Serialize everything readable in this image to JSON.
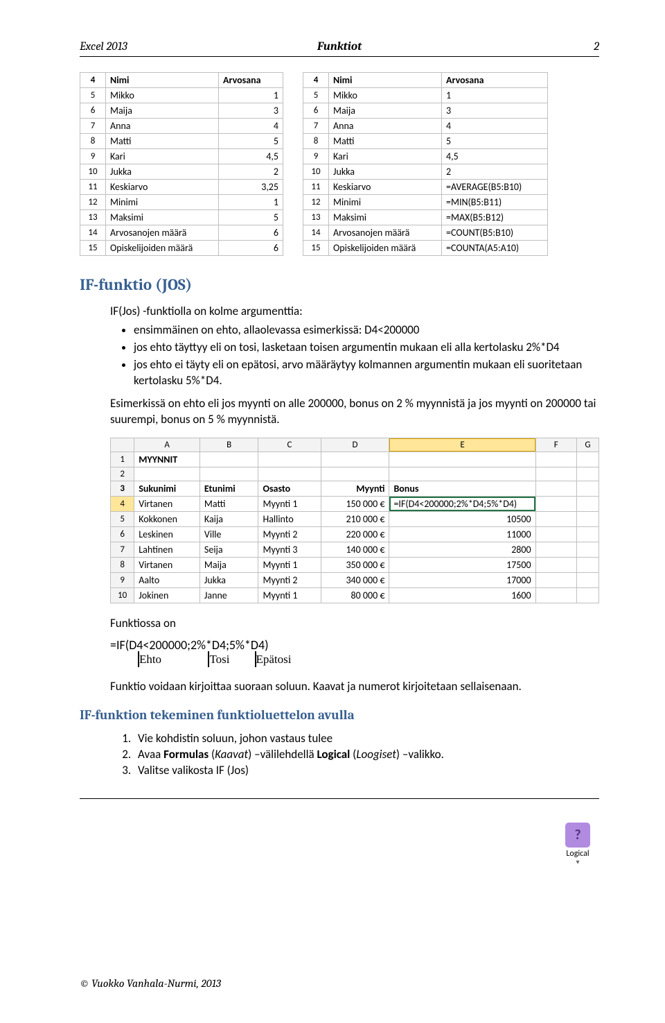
{
  "header": {
    "left": "Excel 2013",
    "center": "Funktiot",
    "right": "2"
  },
  "table_left": {
    "rows": [
      {
        "n": "4",
        "a": "Nimi",
        "b": "Arvosana",
        "bold": true,
        "align": "left"
      },
      {
        "n": "5",
        "a": "Mikko",
        "b": "1"
      },
      {
        "n": "6",
        "a": "Maija",
        "b": "3"
      },
      {
        "n": "7",
        "a": "Anna",
        "b": "4"
      },
      {
        "n": "8",
        "a": "Matti",
        "b": "5"
      },
      {
        "n": "9",
        "a": "Kari",
        "b": "4,5"
      },
      {
        "n": "10",
        "a": "Jukka",
        "b": "2"
      },
      {
        "n": "11",
        "a": "Keskiarvo",
        "b": "3,25"
      },
      {
        "n": "12",
        "a": "Minimi",
        "b": "1"
      },
      {
        "n": "13",
        "a": "Maksimi",
        "b": "5"
      },
      {
        "n": "14",
        "a": "Arvosanojen määrä",
        "b": "6"
      },
      {
        "n": "15",
        "a": "Opiskelijoiden määrä",
        "b": "6"
      }
    ]
  },
  "table_right": {
    "rows": [
      {
        "n": "4",
        "a": "Nimi",
        "b": "Arvosana",
        "bold": true
      },
      {
        "n": "5",
        "a": "Mikko",
        "b": "1"
      },
      {
        "n": "6",
        "a": "Maija",
        "b": "3"
      },
      {
        "n": "7",
        "a": "Anna",
        "b": "4"
      },
      {
        "n": "8",
        "a": "Matti",
        "b": "5"
      },
      {
        "n": "9",
        "a": "Kari",
        "b": "4,5"
      },
      {
        "n": "10",
        "a": "Jukka",
        "b": "2"
      },
      {
        "n": "11",
        "a": "Keskiarvo",
        "b": "=AVERAGE(B5:B10)"
      },
      {
        "n": "12",
        "a": "Minimi",
        "b": "=MIN(B5:B11)"
      },
      {
        "n": "13",
        "a": "Maksimi",
        "b": "=MAX(B5:B12)"
      },
      {
        "n": "14",
        "a": "Arvosanojen määrä",
        "b": "=COUNT(B5:B10)"
      },
      {
        "n": "15",
        "a": "Opiskelijoiden määrä",
        "b": "=COUNTA(A5:A10)"
      }
    ]
  },
  "section_title": "IF-funktio (JOS)",
  "intro": "IF(Jos) -funktiolla on kolme argumenttia:",
  "bullets": [
    "ensimmäinen on ehto, allaolevassa esimerkissä: D4<200000",
    "jos ehto täyttyy eli on tosi, lasketaan toisen argumentin mukaan eli alla kertolasku 2%*D4",
    "jos ehto ei täyty eli on epätosi, arvo määräytyy kolmannen argumentin mukaan eli suoritetaan kertolasku 5%*D4."
  ],
  "example_text": "Esimerkissä on ehto eli jos myynti on alle 200000, bonus on 2 % myynnistä ja jos myynti on 200000 tai suurempi, bonus on 5 % myynnistä.",
  "big_table": {
    "cols": [
      "",
      "A",
      "B",
      "C",
      "D",
      "E",
      "F",
      "G"
    ],
    "rows": [
      {
        "n": "1",
        "cells": [
          "MYYNNIT",
          "",
          "",
          "",
          "",
          "",
          ""
        ],
        "bold": false,
        "boldA": true
      },
      {
        "n": "2",
        "cells": [
          "",
          "",
          "",
          "",
          "",
          "",
          ""
        ]
      },
      {
        "n": "3",
        "cells": [
          "Sukunimi",
          "Etunimi",
          "Osasto",
          "Myynti",
          "Bonus",
          "",
          ""
        ],
        "bold": true
      },
      {
        "n": "4",
        "cells": [
          "Virtanen",
          "Matti",
          "Myynti 1",
          "150 000 €",
          "=IF(D4<200000;2%*D4;5%*D4)",
          "",
          ""
        ],
        "sel": true
      },
      {
        "n": "5",
        "cells": [
          "Kokkonen",
          "Kaija",
          "Hallinto",
          "210 000 €",
          "10500",
          "",
          ""
        ]
      },
      {
        "n": "6",
        "cells": [
          "Leskinen",
          "Ville",
          "Myynti 2",
          "220 000 €",
          "11000",
          "",
          ""
        ]
      },
      {
        "n": "7",
        "cells": [
          "Lahtinen",
          "Seija",
          "Myynti 3",
          "140 000 €",
          "2800",
          "",
          ""
        ]
      },
      {
        "n": "8",
        "cells": [
          "Virtanen",
          "Maija",
          "Myynti 1",
          "350 000 €",
          "17500",
          "",
          ""
        ]
      },
      {
        "n": "9",
        "cells": [
          "Aalto",
          "Jukka",
          "Myynti 2",
          "340 000 €",
          "17000",
          "",
          ""
        ]
      },
      {
        "n": "10",
        "cells": [
          "Jokinen",
          "Janne",
          "Myynti 1",
          "80 000 €",
          "1600",
          "",
          ""
        ]
      }
    ]
  },
  "funktiossa_label": "Funktiossa on",
  "formula": "=IF(D4<200000;2%*D4;5%*D4)",
  "brace_labels": [
    "Ehto",
    "Tosi",
    "Epätosi"
  ],
  "explain": "Funktio voidaan kirjoittaa suoraan soluun. Kaavat ja numerot kirjoitetaan sellaisenaan.",
  "subsection_title": "IF-funktion tekeminen funktioluettelon avulla",
  "steps": [
    "Vie kohdistin soluun, johon vastaus tulee",
    "Avaa Formulas (Kaavat) –välilehdellä Logical (Loogiset) –valikko.",
    "Valitse valikosta  IF (Jos)"
  ],
  "steps_markup": [
    "Vie kohdistin soluun, johon vastaus tulee",
    "Avaa <b>Formulas</b> (<i>Kaavat</i>) –välilehdellä <b>Logical</b> (<i>Loogiset</i>) –valikko.",
    "Valitse valikosta  IF (Jos)"
  ],
  "logical_icon": {
    "glyph": "?",
    "label": "Logical"
  },
  "footer": "© Vuokko Vanhala-Nurmi, 2013"
}
